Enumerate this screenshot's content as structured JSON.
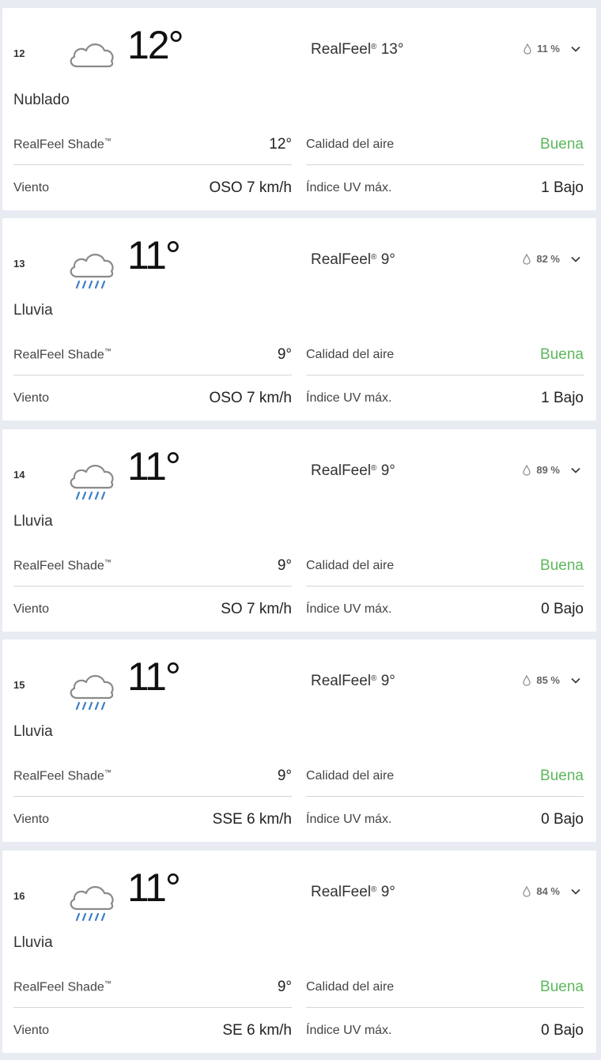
{
  "cards": [
    {
      "hour": "12",
      "icon": "cloudy-icon",
      "temp": "12°",
      "realfeel_label": "RealFeel",
      "realfeel_mark": "®",
      "realfeel_value": "13°",
      "precip": "11 %",
      "phrase": "Nublado",
      "shade_label": "RealFeel Shade",
      "shade_mark": "™",
      "shade_value": "12°",
      "air_label": "Calidad del aire",
      "air_value": "Buena",
      "wind_label": "Viento",
      "wind_value": "OSO 7 km/h",
      "uv_label": "Índice UV máx.",
      "uv_value": "1 Bajo"
    },
    {
      "hour": "13",
      "icon": "rain-icon",
      "temp": "11°",
      "realfeel_label": "RealFeel",
      "realfeel_mark": "®",
      "realfeel_value": "9°",
      "precip": "82 %",
      "phrase": "Lluvia",
      "shade_label": "RealFeel Shade",
      "shade_mark": "™",
      "shade_value": "9°",
      "air_label": "Calidad del aire",
      "air_value": "Buena",
      "wind_label": "Viento",
      "wind_value": "OSO 7 km/h",
      "uv_label": "Índice UV máx.",
      "uv_value": "1 Bajo"
    },
    {
      "hour": "14",
      "icon": "rain-icon",
      "temp": "11°",
      "realfeel_label": "RealFeel",
      "realfeel_mark": "®",
      "realfeel_value": "9°",
      "precip": "89 %",
      "phrase": "Lluvia",
      "shade_label": "RealFeel Shade",
      "shade_mark": "™",
      "shade_value": "9°",
      "air_label": "Calidad del aire",
      "air_value": "Buena",
      "wind_label": "Viento",
      "wind_value": "SO 7 km/h",
      "uv_label": "Índice UV máx.",
      "uv_value": "0 Bajo"
    },
    {
      "hour": "15",
      "icon": "rain-icon",
      "temp": "11°",
      "realfeel_label": "RealFeel",
      "realfeel_mark": "®",
      "realfeel_value": "9°",
      "precip": "85 %",
      "phrase": "Lluvia",
      "shade_label": "RealFeel Shade",
      "shade_mark": "™",
      "shade_value": "9°",
      "air_label": "Calidad del aire",
      "air_value": "Buena",
      "wind_label": "Viento",
      "wind_value": "SSE 6 km/h",
      "uv_label": "Índice UV máx.",
      "uv_value": "0 Bajo"
    },
    {
      "hour": "16",
      "icon": "rain-icon",
      "temp": "11°",
      "realfeel_label": "RealFeel",
      "realfeel_mark": "®",
      "realfeel_value": "9°",
      "precip": "84 %",
      "phrase": "Lluvia",
      "shade_label": "RealFeel Shade",
      "shade_mark": "™",
      "shade_value": "9°",
      "air_label": "Calidad del aire",
      "air_value": "Buena",
      "wind_label": "Viento",
      "wind_value": "SE 6 km/h",
      "uv_label": "Índice UV máx.",
      "uv_value": "0 Bajo"
    }
  ],
  "colors": {
    "background": "#e8ebf2",
    "card": "#ffffff",
    "good_air": "#5cb85c",
    "divider": "#d5d5d5"
  }
}
